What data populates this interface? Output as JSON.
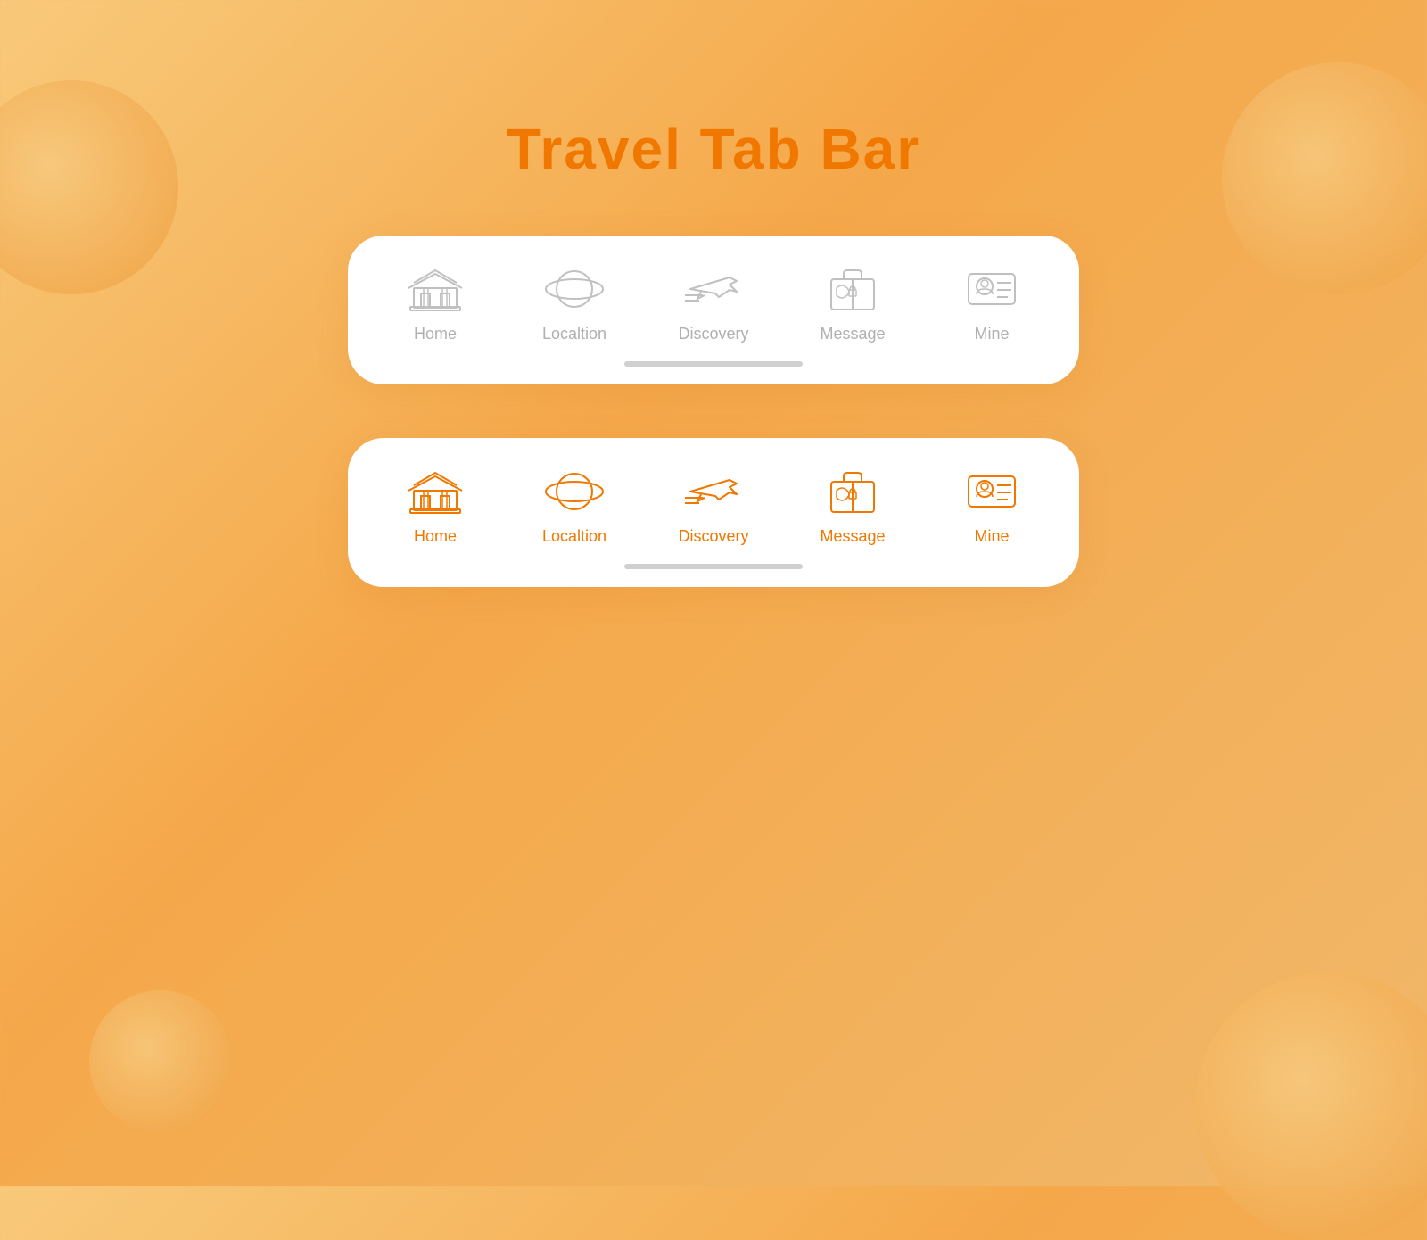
{
  "page": {
    "title": "Travel Tab Bar",
    "accent_color": "#f07800",
    "bg_gradient_start": "#f8c97a",
    "bg_gradient_end": "#f0b86a"
  },
  "tab_bar_inactive": {
    "tabs": [
      {
        "id": "home",
        "label": "Home",
        "active": false
      },
      {
        "id": "location",
        "label": "Localtion",
        "active": false
      },
      {
        "id": "discovery",
        "label": "Discovery",
        "active": false
      },
      {
        "id": "message",
        "label": "Message",
        "active": false
      },
      {
        "id": "mine",
        "label": "Mine",
        "active": false
      }
    ]
  },
  "tab_bar_active": {
    "tabs": [
      {
        "id": "home",
        "label": "Home",
        "active": true
      },
      {
        "id": "location",
        "label": "Localtion",
        "active": true
      },
      {
        "id": "discovery",
        "label": "Discovery",
        "active": true
      },
      {
        "id": "message",
        "label": "Message",
        "active": true
      },
      {
        "id": "mine",
        "label": "Mine",
        "active": true
      }
    ]
  }
}
